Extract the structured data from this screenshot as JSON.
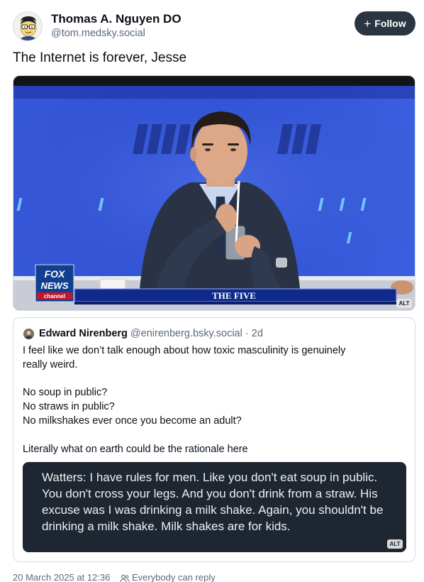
{
  "author": {
    "display_name": "Thomas A. Nguyen DO",
    "handle": "@tom.medsky.social",
    "avatar_icon": "cartoon-avatar-icon"
  },
  "follow_button": {
    "label": "Follow",
    "icon": "plus-icon"
  },
  "post": {
    "text": "The Internet is forever, Jesse"
  },
  "media": {
    "description_icon": "tv-still-image",
    "network_logo_lines": [
      "FOX",
      "NEWS",
      "channel"
    ],
    "show_name": "THE FIVE",
    "alt_badge": "ALT"
  },
  "quote": {
    "display_name": "Edward Nirenberg",
    "handle": "@enirenberg.bsky.social",
    "separator": "·",
    "time": "2d",
    "text_lines": [
      "I feel like we don’t talk enough about how toxic masculinity is genuinely",
      "really weird.",
      "No soup in public?",
      "No straws in public?",
      "No milkshakes ever once you become an adult?",
      "Literally what on earth could be the rationale here"
    ],
    "image_text": "Watters: I have rules for men. Like you don't eat soup in public. You don't cross your legs. And you don't drink from a straw. His excuse was I was drinking a milk shake. Again, you shouldn't be drinking a milk shake. Milk shakes are for kids.",
    "alt_badge": "ALT"
  },
  "footer": {
    "timestamp": "20 March 2025 at 12:36",
    "reply_setting": "Everybody can reply",
    "reply_icon": "people-icon"
  }
}
